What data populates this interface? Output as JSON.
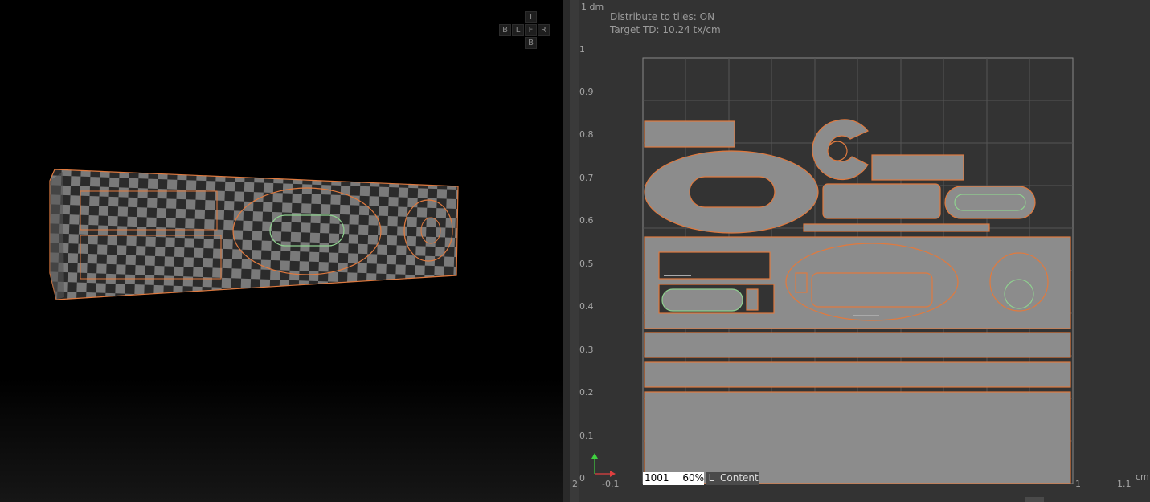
{
  "viewport": {
    "nav_cube": {
      "top": "T",
      "left": "B",
      "left2": "L",
      "front": "F",
      "right": "R",
      "bottom": "B"
    }
  },
  "uv_editor": {
    "hud": {
      "distribute": "Distribute to tiles: ON",
      "target_td": "Target TD: 10.24 tx/cm"
    },
    "ruler_unit_v": "1 dm",
    "ruler_unit_h": "cm",
    "v_ticks": [
      "1",
      "0.9",
      "0.8",
      "0.7",
      "0.6",
      "0.5",
      "0.4",
      "0.3",
      "0.2",
      "0.1",
      "0"
    ],
    "h_ticks": [
      "2",
      "-0.1",
      "1",
      "1.1"
    ],
    "tile_id": "1001",
    "zoom": "60%",
    "lock": "L",
    "mode": "Content"
  },
  "colors": {
    "accent": "#e07a3f",
    "island_fill": "#8c8c8c",
    "grid": "#555555",
    "background": "#333333",
    "checker_light": "#7a7a7a",
    "checker_dark": "#2b2b2b"
  }
}
